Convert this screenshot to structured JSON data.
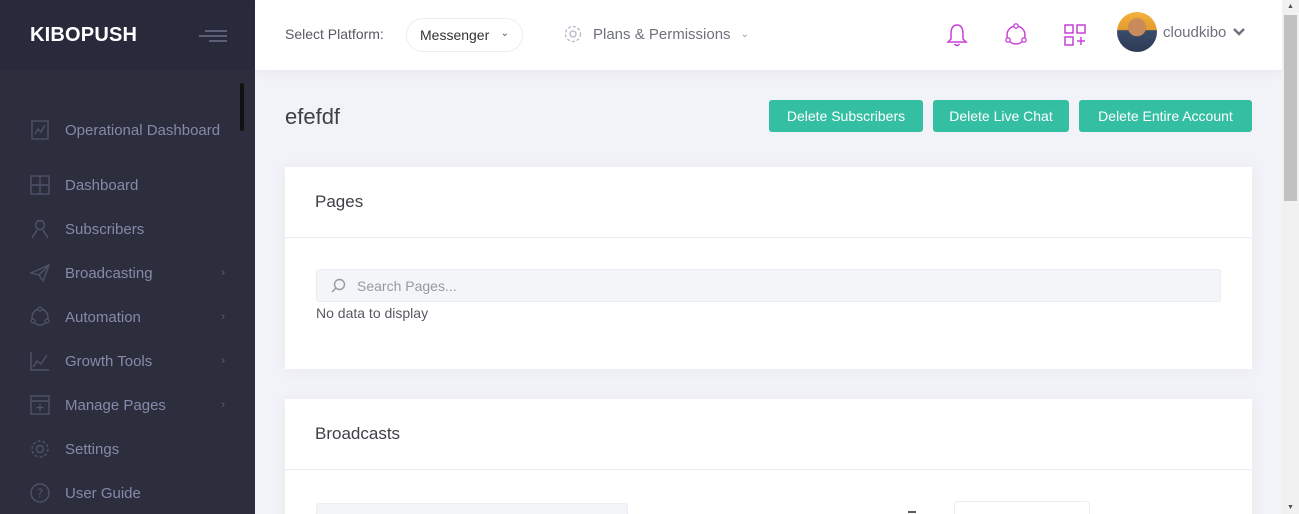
{
  "brand": {
    "name": "KIBOPUSH"
  },
  "sidebar": {
    "items": [
      {
        "label": "Operational Dashboard",
        "icon": "line-chart-icon",
        "has_submenu": false
      },
      {
        "label": "Dashboard",
        "icon": "grid-icon",
        "has_submenu": false
      },
      {
        "label": "Subscribers",
        "icon": "user-icon",
        "has_submenu": false
      },
      {
        "label": "Broadcasting",
        "icon": "paper-plane-icon",
        "has_submenu": true
      },
      {
        "label": "Automation",
        "icon": "network-icon",
        "has_submenu": true
      },
      {
        "label": "Growth Tools",
        "icon": "bar-chart-icon",
        "has_submenu": true
      },
      {
        "label": "Manage Pages",
        "icon": "add-page-icon",
        "has_submenu": true
      },
      {
        "label": "Settings",
        "icon": "gear-icon",
        "has_submenu": false
      },
      {
        "label": "User Guide",
        "icon": "question-icon",
        "has_submenu": false
      }
    ]
  },
  "header": {
    "platform_label": "Select Platform:",
    "platform_value": "Messenger",
    "plans_label": "Plans & Permissions",
    "username": "cloudkibo"
  },
  "page": {
    "title": "efefdf",
    "buttons": {
      "delete_subscribers": "Delete Subscribers",
      "delete_live_chat": "Delete Live Chat",
      "delete_entire_account": "Delete Entire Account"
    }
  },
  "pages_section": {
    "title": "Pages",
    "search_placeholder": "Search Pages...",
    "empty_text": "No data to display"
  },
  "broadcasts_section": {
    "title": "Broadcasts"
  },
  "colors": {
    "sidebar_bg": "#2c2e3e",
    "brand_bg": "#282a3c",
    "accent_button": "#34bfa3",
    "header_icon": "#c640d6"
  }
}
